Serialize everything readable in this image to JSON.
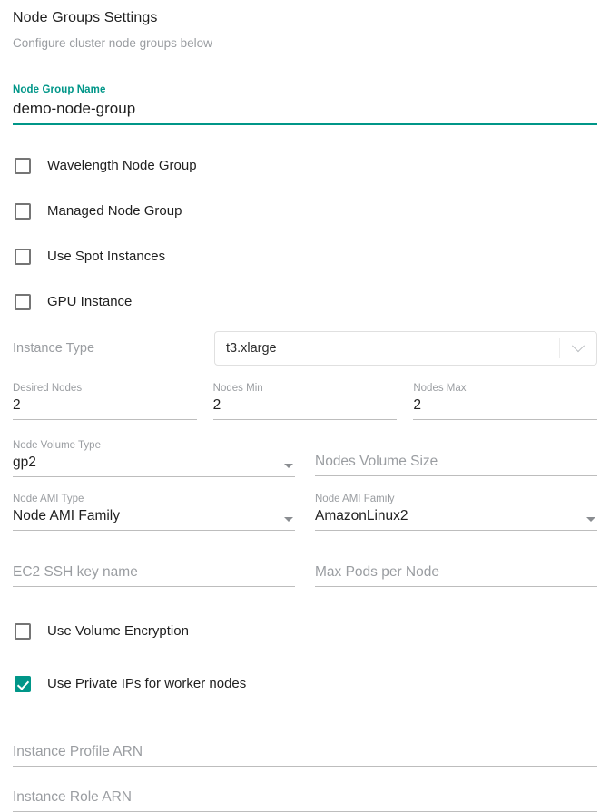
{
  "header": {
    "title": "Node Groups Settings",
    "subtitle": "Configure cluster node groups below"
  },
  "node_group_name": {
    "label": "Node Group Name",
    "value": "demo-node-group",
    "accent_color": "#009688"
  },
  "checkboxes_top": [
    {
      "label": "Wavelength Node Group",
      "checked": false
    },
    {
      "label": "Managed Node Group",
      "checked": false
    },
    {
      "label": "Use Spot Instances",
      "checked": false
    },
    {
      "label": "GPU Instance",
      "checked": false
    }
  ],
  "instance_type": {
    "label": "Instance Type",
    "value": "t3.xlarge",
    "icon": "chevron-down-icon"
  },
  "node_counts": [
    {
      "label": "Desired Nodes",
      "value": "2"
    },
    {
      "label": "Nodes Min",
      "value": "2"
    },
    {
      "label": "Nodes Max",
      "value": "2"
    }
  ],
  "node_volume_type": {
    "label": "Node Volume Type",
    "value": "gp2",
    "icon": "caret-down-icon"
  },
  "nodes_volume_size": {
    "placeholder": "Nodes Volume Size",
    "value": ""
  },
  "node_ami_type": {
    "label": "Node AMI Type",
    "value": "Node AMI Family",
    "icon": "caret-down-icon"
  },
  "node_ami_family": {
    "label": "Node AMI Family",
    "value": "AmazonLinux2",
    "icon": "caret-down-icon"
  },
  "ec2_ssh_key": {
    "placeholder": "EC2 SSH key name",
    "value": ""
  },
  "max_pods_per_node": {
    "placeholder": "Max Pods per Node",
    "value": ""
  },
  "checkboxes_bottom": [
    {
      "label": "Use Volume Encryption",
      "checked": false
    },
    {
      "label": "Use Private IPs for worker nodes",
      "checked": true
    }
  ],
  "instance_profile_arn": {
    "placeholder": "Instance Profile ARN",
    "value": ""
  },
  "instance_role_arn": {
    "placeholder": "Instance Role ARN",
    "value": ""
  }
}
